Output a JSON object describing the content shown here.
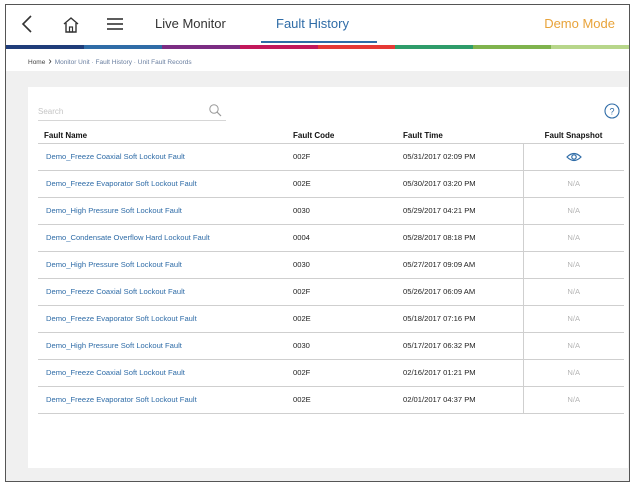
{
  "nav": {
    "live_monitor": "Live Monitor",
    "fault_history": "Fault History",
    "demo_mode": "Demo Mode",
    "accent_color": "#2f6ca7",
    "demo_color": "#e8a33a",
    "color_bar": [
      "#1f3d7a",
      "#2f6ca7",
      "#7b2d83",
      "#c2185b",
      "#e53935",
      "#2e9c6a",
      "#7fb34d",
      "#b7d68a"
    ]
  },
  "breadcrumb": {
    "home": "Home",
    "monitor_unit": "Monitor Unit",
    "fault_history": "Fault History",
    "unit_fault_records": "Unit Fault Records"
  },
  "search": {
    "placeholder": "Search",
    "value": ""
  },
  "table": {
    "headers": {
      "fault_name": "Fault Name",
      "fault_code": "Fault Code",
      "fault_time": "Fault Time",
      "fault_snapshot": "Fault Snapshot"
    },
    "rows": [
      {
        "name": "Demo_Freeze Coaxial Soft Lockout Fault",
        "code": "002F",
        "time": "05/31/2017 02:09 PM",
        "snapshot": "eye-icon"
      },
      {
        "name": "Demo_Freeze Evaporator Soft Lockout Fault",
        "code": "002E",
        "time": "05/30/2017 03:20 PM",
        "snapshot": "N/A"
      },
      {
        "name": "Demo_High Pressure Soft Lockout Fault",
        "code": "0030",
        "time": "05/29/2017 04:21 PM",
        "snapshot": "N/A"
      },
      {
        "name": "Demo_Condensate Overflow Hard Lockout Fault",
        "code": "0004",
        "time": "05/28/2017 08:18 PM",
        "snapshot": "N/A"
      },
      {
        "name": "Demo_High Pressure Soft Lockout Fault",
        "code": "0030",
        "time": "05/27/2017 09:09 AM",
        "snapshot": "N/A"
      },
      {
        "name": "Demo_Freeze Coaxial Soft Lockout Fault",
        "code": "002F",
        "time": "05/26/2017 06:09 AM",
        "snapshot": "N/A"
      },
      {
        "name": "Demo_Freeze Evaporator Soft Lockout Fault",
        "code": "002E",
        "time": "05/18/2017 07:16 PM",
        "snapshot": "N/A"
      },
      {
        "name": "Demo_High Pressure Soft Lockout Fault",
        "code": "0030",
        "time": "05/17/2017 06:32 PM",
        "snapshot": "N/A"
      },
      {
        "name": "Demo_Freeze Coaxial Soft Lockout Fault",
        "code": "002F",
        "time": "02/16/2017 01:21 PM",
        "snapshot": "N/A"
      },
      {
        "name": "Demo_Freeze Evaporator Soft Lockout Fault",
        "code": "002E",
        "time": "02/01/2017 04:37 PM",
        "snapshot": "N/A"
      }
    ]
  }
}
